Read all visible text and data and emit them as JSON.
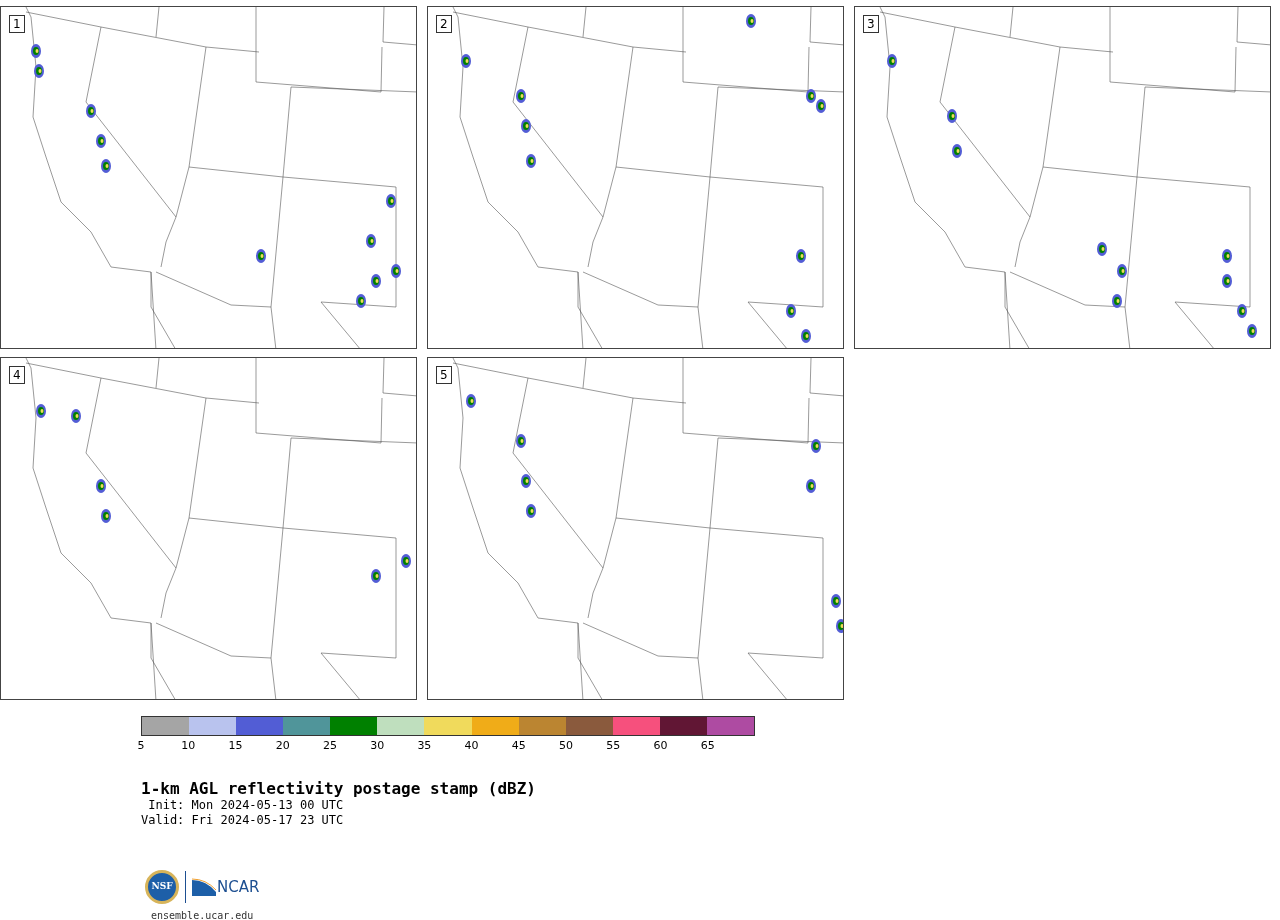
{
  "panels": [
    {
      "label": "1"
    },
    {
      "label": "2"
    },
    {
      "label": "3"
    },
    {
      "label": "4"
    },
    {
      "label": "5"
    }
  ],
  "colorbar": {
    "bins": [
      {
        "color": "#a5a5a5"
      },
      {
        "color": "#b9c3ee"
      },
      {
        "color": "#525dd5"
      },
      {
        "color": "#50959a"
      },
      {
        "color": "#008000"
      },
      {
        "color": "#bfdfbe"
      },
      {
        "color": "#f0da5c"
      },
      {
        "color": "#f0ac18"
      },
      {
        "color": "#bb8531"
      },
      {
        "color": "#8a5a3d"
      },
      {
        "color": "#f6507d"
      },
      {
        "color": "#611634"
      },
      {
        "color": "#ae4ba2"
      }
    ],
    "ticks": [
      "5",
      "10",
      "15",
      "20",
      "25",
      "30",
      "35",
      "40",
      "45",
      "50",
      "55",
      "60",
      "65"
    ]
  },
  "title": "1-km AGL reflectivity postage stamp (dBZ)",
  "init": " Init: Mon 2024-05-13 00 UTC",
  "valid": "Valid: Fri 2024-05-17 23 UTC",
  "logos": {
    "nsf": "NSF",
    "ncar": "NCAR"
  },
  "url": "ensemble.ucar.edu"
}
